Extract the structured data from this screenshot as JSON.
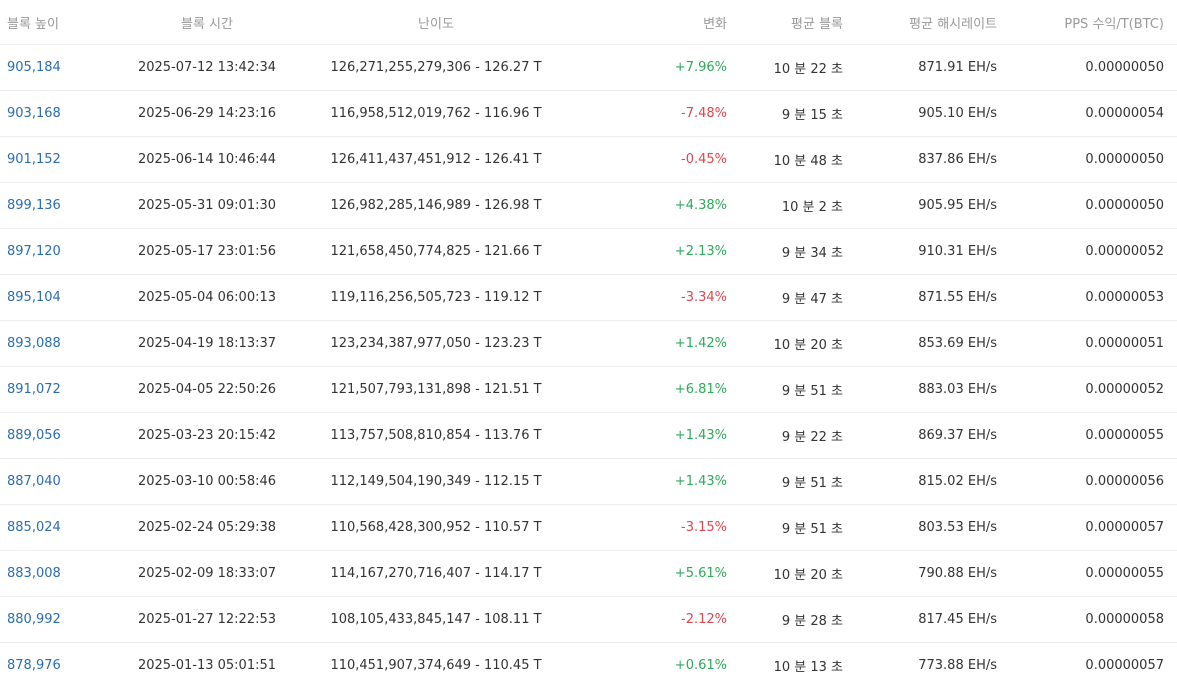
{
  "columns": {
    "height": "블록 높이",
    "time": "블록 시간",
    "difficulty": "난이도",
    "change": "변화",
    "avg_block": "평균 블록",
    "avg_hashrate": "평균 해시레이트",
    "pps": "PPS 수익/T(BTC)"
  },
  "colors": {
    "link": "#2a6db0",
    "positive": "#2eaa5a",
    "negative": "#e0474c"
  },
  "rows": [
    {
      "height": "905,184",
      "time": "2025-07-12 13:42:34",
      "difficulty": "126,271,255,279,306 - 126.27 T",
      "change": "+7.96%",
      "trend": "pos",
      "avg_block": "10 분 22 초",
      "avg_hashrate": "871.91 EH/s",
      "pps": "0.00000050"
    },
    {
      "height": "903,168",
      "time": "2025-06-29 14:23:16",
      "difficulty": "116,958,512,019,762 - 116.96 T",
      "change": "-7.48%",
      "trend": "neg",
      "avg_block": "9 분 15 초",
      "avg_hashrate": "905.10 EH/s",
      "pps": "0.00000054"
    },
    {
      "height": "901,152",
      "time": "2025-06-14 10:46:44",
      "difficulty": "126,411,437,451,912 - 126.41 T",
      "change": "-0.45%",
      "trend": "neg",
      "avg_block": "10 분 48 초",
      "avg_hashrate": "837.86 EH/s",
      "pps": "0.00000050"
    },
    {
      "height": "899,136",
      "time": "2025-05-31 09:01:30",
      "difficulty": "126,982,285,146,989 - 126.98 T",
      "change": "+4.38%",
      "trend": "pos",
      "avg_block": "10 분 2 초",
      "avg_hashrate": "905.95 EH/s",
      "pps": "0.00000050"
    },
    {
      "height": "897,120",
      "time": "2025-05-17 23:01:56",
      "difficulty": "121,658,450,774,825 - 121.66 T",
      "change": "+2.13%",
      "trend": "pos",
      "avg_block": "9 분 34 초",
      "avg_hashrate": "910.31 EH/s",
      "pps": "0.00000052"
    },
    {
      "height": "895,104",
      "time": "2025-05-04 06:00:13",
      "difficulty": "119,116,256,505,723 - 119.12 T",
      "change": "-3.34%",
      "trend": "neg",
      "avg_block": "9 분 47 초",
      "avg_hashrate": "871.55 EH/s",
      "pps": "0.00000053"
    },
    {
      "height": "893,088",
      "time": "2025-04-19 18:13:37",
      "difficulty": "123,234,387,977,050 - 123.23 T",
      "change": "+1.42%",
      "trend": "pos",
      "avg_block": "10 분 20 초",
      "avg_hashrate": "853.69 EH/s",
      "pps": "0.00000051"
    },
    {
      "height": "891,072",
      "time": "2025-04-05 22:50:26",
      "difficulty": "121,507,793,131,898 - 121.51 T",
      "change": "+6.81%",
      "trend": "pos",
      "avg_block": "9 분 51 초",
      "avg_hashrate": "883.03 EH/s",
      "pps": "0.00000052"
    },
    {
      "height": "889,056",
      "time": "2025-03-23 20:15:42",
      "difficulty": "113,757,508,810,854 - 113.76 T",
      "change": "+1.43%",
      "trend": "pos",
      "avg_block": "9 분 22 초",
      "avg_hashrate": "869.37 EH/s",
      "pps": "0.00000055"
    },
    {
      "height": "887,040",
      "time": "2025-03-10 00:58:46",
      "difficulty": "112,149,504,190,349 - 112.15 T",
      "change": "+1.43%",
      "trend": "pos",
      "avg_block": "9 분 51 초",
      "avg_hashrate": "815.02 EH/s",
      "pps": "0.00000056"
    },
    {
      "height": "885,024",
      "time": "2025-02-24 05:29:38",
      "difficulty": "110,568,428,300,952 - 110.57 T",
      "change": "-3.15%",
      "trend": "neg",
      "avg_block": "9 분 51 초",
      "avg_hashrate": "803.53 EH/s",
      "pps": "0.00000057"
    },
    {
      "height": "883,008",
      "time": "2025-02-09 18:33:07",
      "difficulty": "114,167,270,716,407 - 114.17 T",
      "change": "+5.61%",
      "trend": "pos",
      "avg_block": "10 분 20 초",
      "avg_hashrate": "790.88 EH/s",
      "pps": "0.00000055"
    },
    {
      "height": "880,992",
      "time": "2025-01-27 12:22:53",
      "difficulty": "108,105,433,845,147 - 108.11 T",
      "change": "-2.12%",
      "trend": "neg",
      "avg_block": "9 분 28 초",
      "avg_hashrate": "817.45 EH/s",
      "pps": "0.00000058"
    },
    {
      "height": "878,976",
      "time": "2025-01-13 05:01:51",
      "difficulty": "110,451,907,374,649 - 110.45 T",
      "change": "+0.61%",
      "trend": "pos",
      "avg_block": "10 분 13 초",
      "avg_hashrate": "773.88 EH/s",
      "pps": "0.00000057"
    }
  ]
}
